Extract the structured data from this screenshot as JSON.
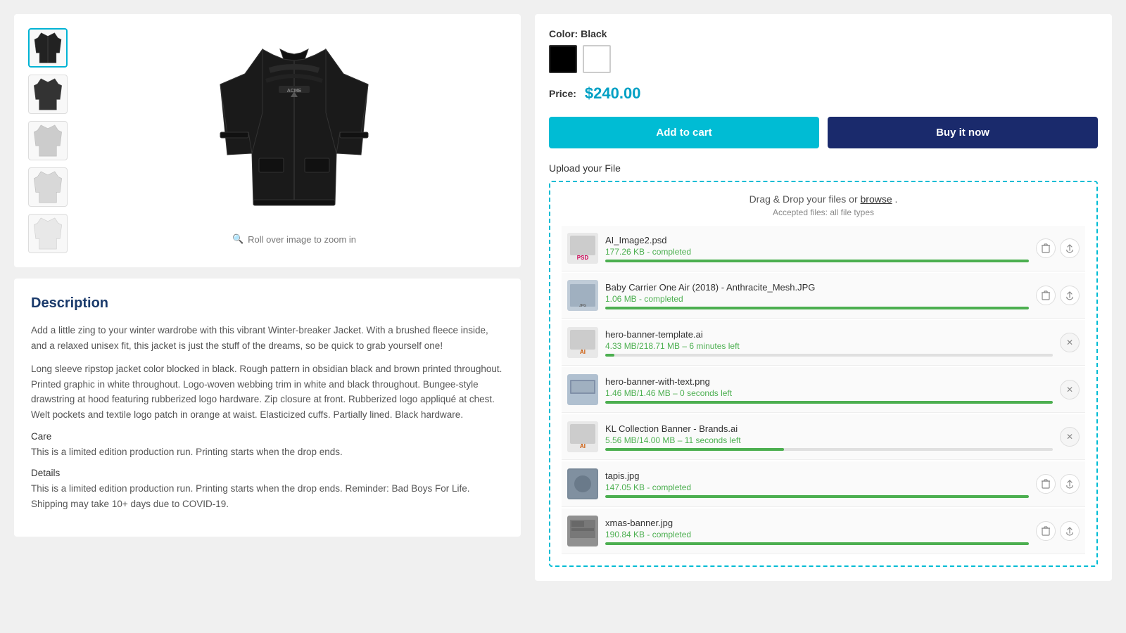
{
  "product": {
    "color_label": "Color:",
    "color_value": "Black",
    "price_label": "Price:",
    "price_value": "$240.00",
    "add_to_cart": "Add to cart",
    "buy_it_now": "Buy it now",
    "upload_label": "Upload your File",
    "drop_hint": "Drag & Drop your files or",
    "browse_text": "browse",
    "drop_suffix": ".",
    "accepted_files": "Accepted files: all file types",
    "zoom_hint": "Roll over image to zoom in"
  },
  "description": {
    "title": "Description",
    "para1": "Add a little zing to your winter wardrobe with this vibrant Winter-breaker Jacket. With a brushed fleece inside, and a relaxed unisex fit, this jacket is just the stuff of the dreams, so be quick to grab yourself one!",
    "para2": "Long sleeve ripstop jacket color blocked in black. Rough pattern in obsidian black and brown printed throughout. Printed graphic in white throughout. Logo-woven webbing trim in white and black throughout. Bungee-style drawstring at hood featuring rubberized logo hardware. Zip closure at front. Rubberized logo appliqué at chest. Welt pockets and textile logo patch in orange at waist. Elasticized cuffs. Partially lined. Black hardware.",
    "care_label": "Care",
    "care_text": "This is a limited edition production run. Printing starts when the drop ends.",
    "details_label": "Details",
    "details_text": "This is a limited edition production run. Printing starts when the drop ends. Reminder: Bad Boys For Life. Shipping may take 10+ days due to COVID-19."
  },
  "files": [
    {
      "name": "AI_Image2.psd",
      "status": "177.26 KB - completed",
      "progress": 100,
      "type": "psd",
      "actions": [
        "delete",
        "upload"
      ],
      "thumbnail_color": "#e8e8e8"
    },
    {
      "name": "Baby Carrier One Air (2018) - Anthracite_Mesh.JPG",
      "status": "1.06 MB - completed",
      "progress": 100,
      "type": "jpg",
      "actions": [
        "delete",
        "upload"
      ],
      "thumbnail_color": "#c8d4e0"
    },
    {
      "name": "hero-banner-template.ai",
      "status": "4.33 MB/218.71 MB – 6 minutes left",
      "progress": 2,
      "type": "ai",
      "actions": [
        "close"
      ],
      "thumbnail_color": "#e8e8e8"
    },
    {
      "name": "hero-banner-with-text.png",
      "status": "1.46 MB/1.46 MB – 0 seconds left",
      "progress": 100,
      "type": "png",
      "actions": [
        "close"
      ],
      "thumbnail_color": "#b8c8d8"
    },
    {
      "name": "KL Collection Banner - Brands.ai",
      "status": "5.56 MB/14.00 MB – 11 seconds left",
      "progress": 40,
      "type": "ai",
      "actions": [
        "close"
      ],
      "thumbnail_color": "#e8e8e8"
    },
    {
      "name": "tapis.jpg",
      "status": "147.05 KB - completed",
      "progress": 100,
      "type": "jpg",
      "actions": [
        "delete",
        "upload"
      ],
      "thumbnail_color": "#8090a0"
    },
    {
      "name": "xmas-banner.jpg",
      "status": "190.84 KB - completed",
      "progress": 100,
      "type": "jpg",
      "actions": [
        "delete",
        "upload"
      ],
      "thumbnail_color": "#909090"
    }
  ],
  "colors": {
    "accent": "#00bcd4",
    "buy_btn": "#1a2a6c",
    "completed_green": "#4caf50",
    "price_color": "#00a0c4"
  }
}
